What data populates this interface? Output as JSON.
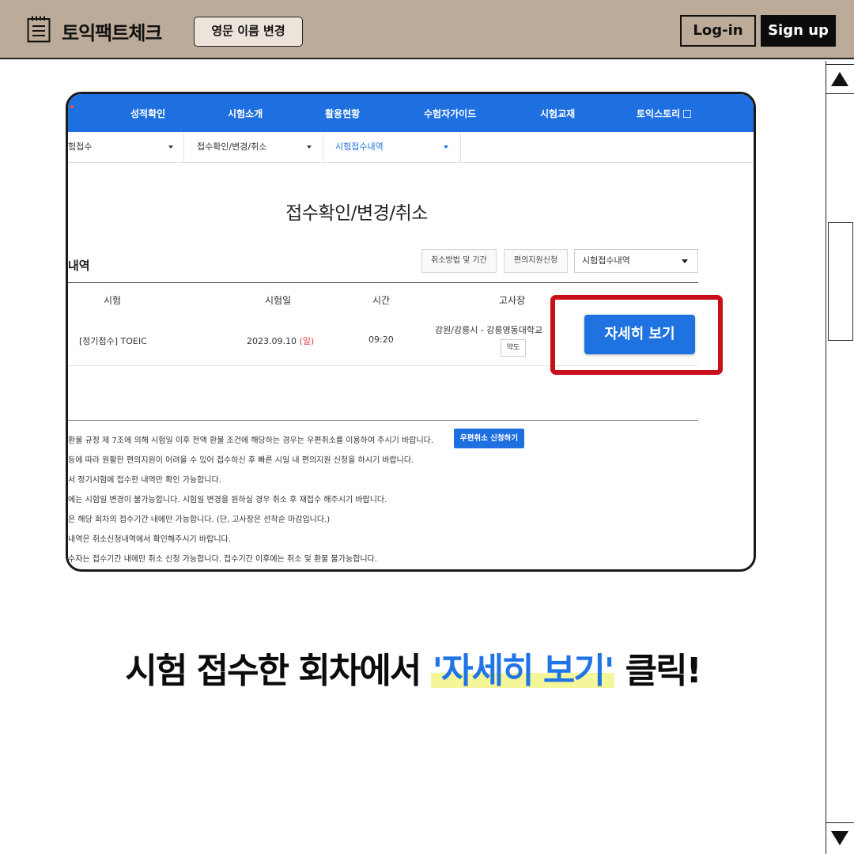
{
  "header": {
    "brand": "토익팩트체크",
    "name_change_button": "영문 이름 변경",
    "login_button": "Log-in",
    "signup_button": "Sign up"
  },
  "screenshot": {
    "top_nav": [
      "성적확인",
      "시험소개",
      "활용현황",
      "수험자가이드",
      "시험교재",
      "토익스토리"
    ],
    "sub_nav": [
      "험접수",
      "접수확인/변경/취소",
      "시험접수내역"
    ],
    "page_title": "접수확인/변경/취소",
    "section_label": "내역",
    "buttons": {
      "cancel_method": "취소방법 및 기간",
      "convenience": "편의지원신청",
      "select_value": "시험접수내역"
    },
    "table": {
      "headers": [
        "시험",
        "시험일",
        "시간",
        "고사장"
      ],
      "row": {
        "exam": "[정기접수] TOEIC",
        "date": "2023.09.10",
        "day": "(일)",
        "time": "09:20",
        "venue": "강원/강릉시 - 강릉영동대학교",
        "map_button": "약도"
      }
    },
    "detail_button": "자세히 보기",
    "notes": [
      "환불 규정 제 7조에 의해 시험일 이후 전액 환불 조건에 해당하는 경우는 우편취소를 이용하여 주시기 바랍니다.",
      "등에 따라 원활한 편의지원이 어려울 수 있어 접수하신 후 빠른 시일 내 편의지원 신청을 하시기 바랍니다.",
      "서 정기시험에 접수한 내역만 확인 가능합니다.",
      "에는 시험일 변경이 불가능합니다. 시험일 변경을 원하실 경우 취소 후 재접수 해주시기 바랍니다.",
      "은 해당 회차의 접수기간 내에만 가능합니다. (단, 고사장은 선착순 마감입니다.)",
      "내역은 취소신청내역에서 확인해주시기 바랍니다.",
      "수자는 접수기간 내에만 취소 신청 가능합니다. 접수기간 이후에는 취소 및 환불 불가능합니다."
    ],
    "mail_cancel_button": "우편취소 신청하기"
  },
  "caption": {
    "prefix": "시험 접수한 회차에서 ",
    "highlight": "'자세히 보기'",
    "suffix": " 클릭!"
  },
  "colors": {
    "header_bg": "#bcab98",
    "brand_blue": "#1e6fe0",
    "highlight_red": "#c8101a",
    "caption_blue": "#1f74e6",
    "marker_yellow": "#f5f59a"
  }
}
